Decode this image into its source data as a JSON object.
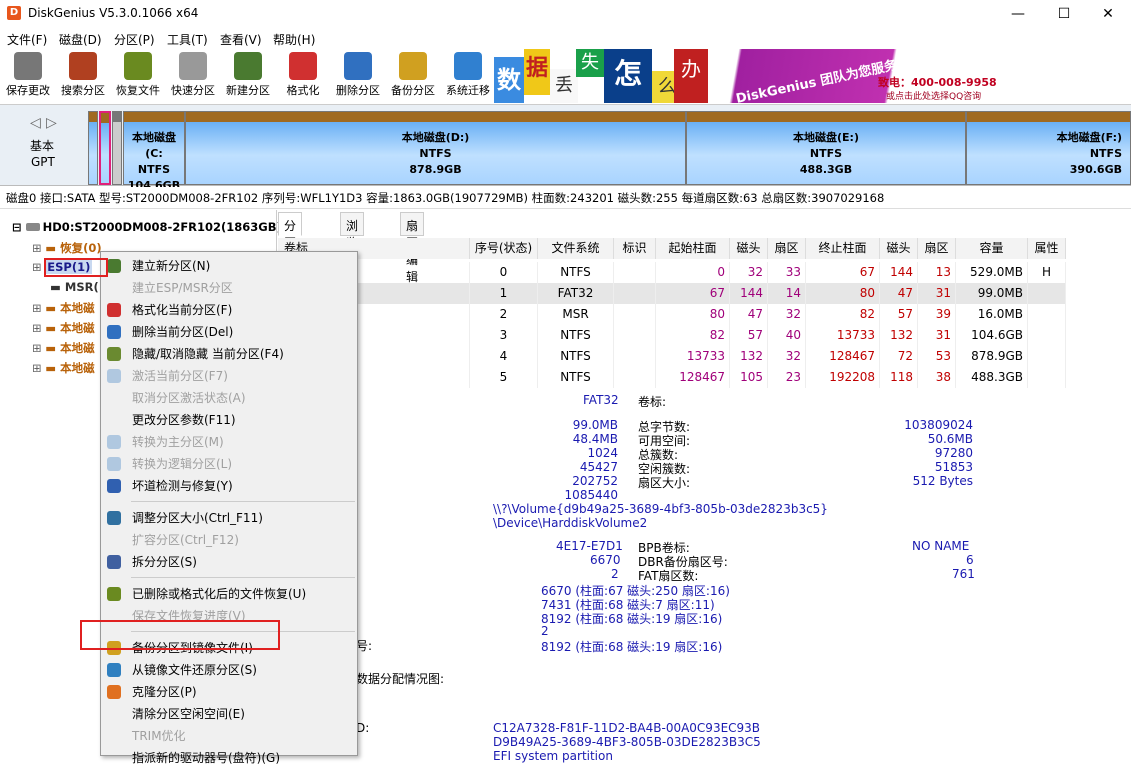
{
  "window": {
    "title": "DiskGenius V5.3.0.1066 x64",
    "icon_letter": "D",
    "minimize": "—",
    "maximize": "☐",
    "close": "✕"
  },
  "menu": [
    "文件(F)",
    "磁盘(D)",
    "分区(P)",
    "工具(T)",
    "查看(V)",
    "帮助(H)"
  ],
  "toolbar": [
    {
      "label": "保存更改",
      "icon": "save-icon",
      "color": "#777"
    },
    {
      "label": "搜索分区",
      "icon": "search-icon",
      "color": "#b04020"
    },
    {
      "label": "恢复文件",
      "icon": "recover-icon",
      "color": "#6a8a20"
    },
    {
      "label": "快速分区",
      "icon": "quick-partition-icon",
      "color": "#999"
    },
    {
      "label": "新建分区",
      "icon": "new-partition-icon",
      "color": "#4a7a30"
    },
    {
      "label": "格式化",
      "icon": "format-icon",
      "color": "#d03030"
    },
    {
      "label": "删除分区",
      "icon": "delete-icon",
      "color": "#3070c0"
    },
    {
      "label": "备份分区",
      "icon": "backup-icon",
      "color": "#d0a020"
    },
    {
      "label": "系统迁移",
      "icon": "migrate-icon",
      "color": "#3080d0"
    }
  ],
  "banner": {
    "chars": [
      "数",
      "据",
      "丢",
      "失",
      "怎",
      "么",
      "办",
      "!"
    ],
    "brand": "DiskGenius 团队为您服务",
    "phone": "致电：400-008-9958",
    "qq": "或点击此处选择QQ咨询"
  },
  "diskmap": {
    "nav_left": "◁",
    "nav_right": "▷",
    "type1": "基本",
    "type2": "GPT",
    "partitions": [
      {
        "name": "本地磁盘(C:",
        "fs": "NTFS",
        "size": "104.6GB"
      },
      {
        "name": "本地磁盘(D:)",
        "fs": "NTFS",
        "size": "878.9GB"
      },
      {
        "name": "本地磁盘(E:)",
        "fs": "NTFS",
        "size": "488.3GB"
      },
      {
        "name": "本地磁盘(F:)",
        "fs": "NTFS",
        "size": "390.6GB"
      }
    ]
  },
  "diskinfo": "磁盘0 接口:SATA  型号:ST2000DM008-2FR102  序列号:WFL1Y1D3  容量:1863.0GB(1907729MB)  柱面数:243201  磁头数:255  每道扇区数:63  总扇区数:3907029168",
  "tree": {
    "root": "HD0:ST2000DM008-2FR102(1863GB)",
    "items": [
      "恢复(0)",
      "ESP(1)",
      "MSR(",
      "本地磁",
      "本地磁",
      "本地磁",
      "本地磁"
    ]
  },
  "tabs": [
    "分区参数",
    "浏览文件",
    "扇区编辑"
  ],
  "grid": {
    "headers": [
      "卷标",
      "序号(状态)",
      "文件系统",
      "标识",
      "起始柱面",
      "磁头",
      "扇区",
      "终止柱面",
      "磁头",
      "扇区",
      "容量",
      "属性"
    ],
    "rows": [
      {
        "label": "",
        "no": "0",
        "fs": "NTFS",
        "id": "",
        "sc": "0",
        "sh": "32",
        "ss": "33",
        "ec": "67",
        "eh": "144",
        "es": "13",
        "cap": "529.0MB",
        "attr": "H"
      },
      {
        "label": "",
        "no": "1",
        "fs": "FAT32",
        "id": "",
        "sc": "67",
        "sh": "144",
        "ss": "14",
        "ec": "80",
        "eh": "47",
        "es": "31",
        "cap": "99.0MB",
        "attr": ""
      },
      {
        "label": "",
        "no": "2",
        "fs": "MSR",
        "id": "",
        "sc": "80",
        "sh": "47",
        "ss": "32",
        "ec": "82",
        "eh": "57",
        "es": "39",
        "cap": "16.0MB",
        "attr": ""
      },
      {
        "label": "盘(C:)",
        "no": "3",
        "fs": "NTFS",
        "id": "",
        "sc": "82",
        "sh": "57",
        "ss": "40",
        "ec": "13733",
        "eh": "132",
        "es": "31",
        "cap": "104.6GB",
        "attr": ""
      },
      {
        "label": "盘(D:)",
        "no": "4",
        "fs": "NTFS",
        "id": "",
        "sc": "13733",
        "sh": "132",
        "ss": "32",
        "ec": "128467",
        "eh": "72",
        "es": "53",
        "cap": "878.9GB",
        "attr": ""
      },
      {
        "label": "盘(E:)",
        "no": "5",
        "fs": "NTFS",
        "id": "",
        "sc": "128467",
        "sh": "105",
        "ss": "23",
        "ec": "192208",
        "eh": "118",
        "es": "38",
        "cap": "488.3GB",
        "attr": ""
      }
    ]
  },
  "details": {
    "fs": "FAT32",
    "vol_label": "卷标:",
    "left_vals": [
      "99.0MB",
      "48.4MB",
      "1024",
      "45427",
      "202752",
      "1085440"
    ],
    "mid_labels": [
      "总字节数:",
      "可用空间:",
      "总簇数:",
      "空闲簇数:",
      "扇区大小:"
    ],
    "right_vals": [
      "103809024",
      "50.6MB",
      "97280",
      "51853",
      "512 Bytes"
    ],
    "volume": "\\\\?\\Volume{d9b49a25-3689-4bf3-805b-03de2823b3c5}",
    "device": "\\Device\\HarddiskVolume2",
    "serial": "4E17-E7D1",
    "bpb_label": "BPB卷标:",
    "bpb_val": "NO NAME",
    "v6670": "6670",
    "dbr_label": "DBR备份扇区号:",
    "dbr_val": "6",
    "v2": "2",
    "fat_label": "FAT扇区数:",
    "fat_val": "761",
    "pos": [
      "6670 (柱面:67 磁头:250 扇区:16)",
      "7431 (柱面:68 磁头:7 扇区:11)",
      "8192 (柱面:68 磁头:19 扇区:16)",
      "2",
      "8192 (柱面:68 磁头:19 扇区:16)"
    ],
    "hao": "号:",
    "alloc": "数据分配情况图:",
    "d_label": "D:",
    "guid1": "C12A7328-F81F-11D2-BA4B-00A0C93EC93B",
    "guid2": "D9B49A25-3689-4BF3-805B-03DE2823B3C5",
    "guid3": "EFI system partition"
  },
  "context_menu": [
    {
      "label": "建立新分区(N)",
      "dis": false,
      "icon": "new-partition-icon",
      "color": "#4a7a30"
    },
    {
      "label": "建立ESP/MSR分区",
      "dis": true,
      "icon": "",
      "color": ""
    },
    {
      "label": "格式化当前分区(F)",
      "dis": false,
      "icon": "format-icon",
      "color": "#d03030"
    },
    {
      "label": "删除当前分区(Del)",
      "dis": false,
      "icon": "delete-icon",
      "color": "#3070c0"
    },
    {
      "label": "隐藏/取消隐藏 当前分区(F4)",
      "dis": false,
      "icon": "hide-icon",
      "color": "#6a8a30"
    },
    {
      "label": "激活当前分区(F7)",
      "dis": true,
      "icon": "activate-icon",
      "color": "#b0c8e0"
    },
    {
      "label": "取消分区激活状态(A)",
      "dis": true,
      "icon": "",
      "color": ""
    },
    {
      "label": "更改分区参数(F11)",
      "dis": false,
      "icon": "",
      "color": ""
    },
    {
      "label": "转换为主分区(M)",
      "dis": true,
      "icon": "convert-primary-icon",
      "color": "#b0c8e0"
    },
    {
      "label": "转换为逻辑分区(L)",
      "dis": true,
      "icon": "convert-logical-icon",
      "color": "#b0c8e0"
    },
    {
      "label": "坏道检测与修复(Y)",
      "dis": false,
      "icon": "tools-icon",
      "color": "#3060b0"
    },
    {
      "label": "调整分区大小(Ctrl_F11)",
      "dis": false,
      "icon": "resize-icon",
      "color": "#3070a0"
    },
    {
      "label": "扩容分区(Ctrl_F12)",
      "dis": true,
      "icon": "",
      "color": ""
    },
    {
      "label": "拆分分区(S)",
      "dis": false,
      "icon": "split-icon",
      "color": "#4060a0"
    },
    {
      "label": "已删除或格式化后的文件恢复(U)",
      "dis": false,
      "icon": "recover-icon",
      "color": "#6a8a20"
    },
    {
      "label": "保存文件恢复进度(V)",
      "dis": true,
      "icon": "",
      "color": ""
    },
    {
      "label": "备份分区到镜像文件(I)",
      "dis": false,
      "icon": "backup-icon",
      "color": "#d0a020"
    },
    {
      "label": "从镜像文件还原分区(S)",
      "dis": false,
      "icon": "restore-icon",
      "color": "#3080c0"
    },
    {
      "label": "克隆分区(P)",
      "dis": false,
      "icon": "clone-icon",
      "color": "#e07020"
    },
    {
      "label": "清除分区空闲空间(E)",
      "dis": false,
      "icon": "",
      "color": ""
    },
    {
      "label": "TRIM优化",
      "dis": true,
      "icon": "",
      "color": ""
    },
    {
      "label": "指派新的驱动器号(盘符)(G)",
      "dis": false,
      "icon": "",
      "color": ""
    }
  ]
}
